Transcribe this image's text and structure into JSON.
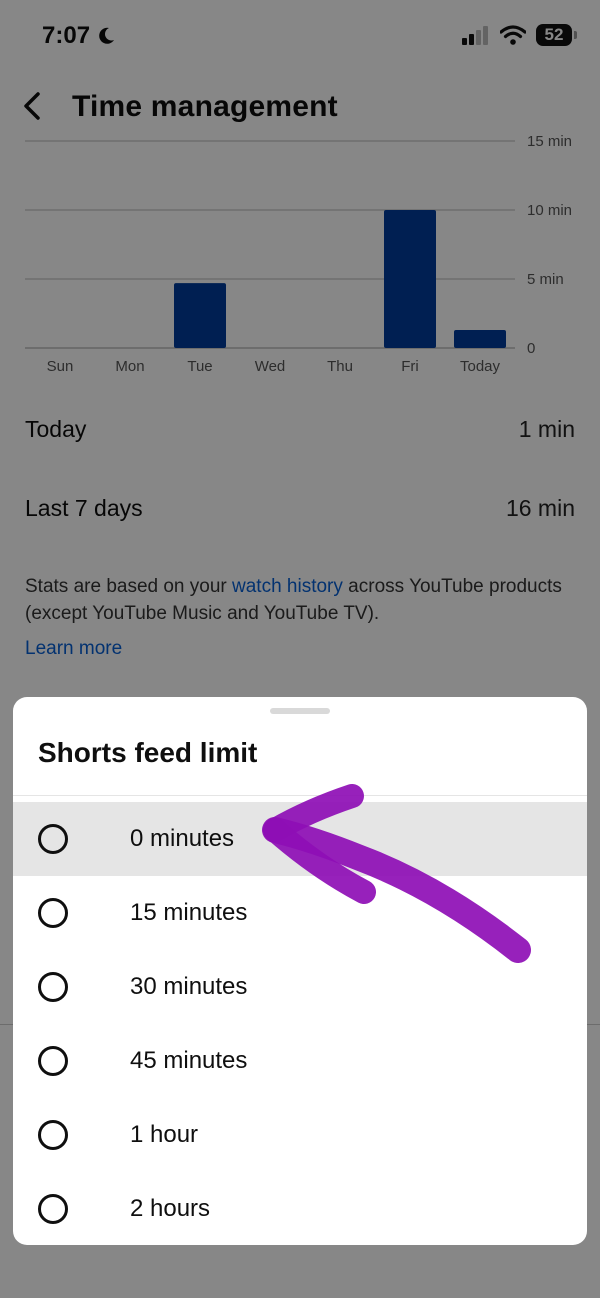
{
  "status_bar": {
    "time": "7:07",
    "battery": "52"
  },
  "header": {
    "title": "Time management"
  },
  "chart_data": {
    "type": "bar",
    "categories": [
      "Sun",
      "Mon",
      "Tue",
      "Wed",
      "Thu",
      "Fri",
      "Today"
    ],
    "values": [
      0,
      0,
      4.7,
      0,
      0,
      10,
      1.3
    ],
    "ylim": [
      0,
      15
    ],
    "y_ticks": [
      "0",
      "5 min",
      "10 min",
      "15 min"
    ],
    "y_tick_values": [
      0,
      5,
      10,
      15
    ],
    "bar_color": "#003b9c",
    "grid": true
  },
  "stats": {
    "today_label": "Today",
    "today_value": "1 min",
    "week_label": "Last 7 days",
    "week_value": "16 min"
  },
  "note": {
    "prefix": "Stats are based on your ",
    "link": "watch history",
    "suffix": " across YouTube products (except YouTube Music and YouTube TV).",
    "learn_more": "Learn more"
  },
  "sheet": {
    "title": "Shorts feed limit",
    "options": [
      {
        "label": "0 minutes",
        "selected": true
      },
      {
        "label": "15 minutes"
      },
      {
        "label": "30 minutes"
      },
      {
        "label": "45 minutes"
      },
      {
        "label": "1 hour"
      },
      {
        "label": "2 hours"
      }
    ]
  },
  "annotation": {
    "color": "#8e0eb5"
  }
}
